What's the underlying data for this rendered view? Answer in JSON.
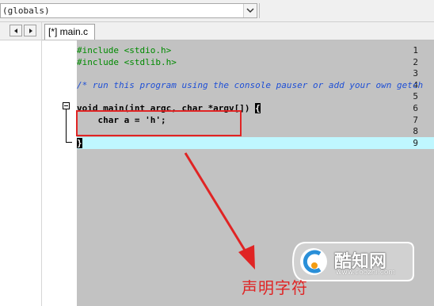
{
  "toolbar": {
    "scope_value": "(globals)"
  },
  "tabs": [
    {
      "label": "[*] main.c"
    }
  ],
  "editor": {
    "line_numbers": [
      "1",
      "2",
      "3",
      "4",
      "5",
      "6",
      "7",
      "8",
      "9"
    ],
    "lines": {
      "l1": "#include <stdio.h>",
      "l2": "#include <stdlib.h>",
      "l4": "/* run this program using the console pauser or add your own getch",
      "l6_pre": "void main(int argc, char *argv[]) ",
      "l6_brace": "{",
      "l7": "    char a = 'h';",
      "l9_brace": "}"
    }
  },
  "annotation": {
    "text": "声明字符",
    "color": "#e02424"
  },
  "watermark": {
    "brand": "酷知网",
    "url": "www.coozhi.com"
  },
  "colors": {
    "preprocessor": "#008a00",
    "comment": "#1e4fd6",
    "current_line": "#bff7ff",
    "editor_bg": "#c2c2c2"
  }
}
